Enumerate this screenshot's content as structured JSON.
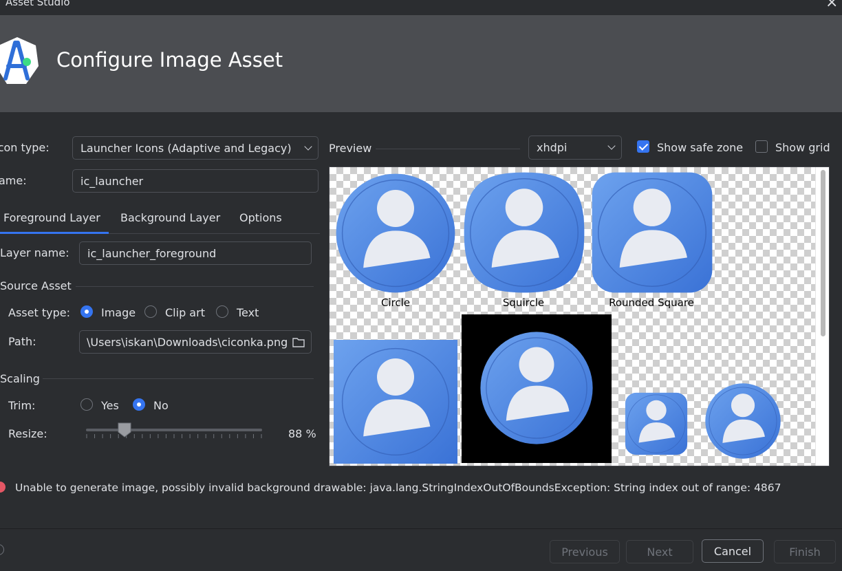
{
  "window": {
    "title": "Asset Studio"
  },
  "header": {
    "title": "Configure Image Asset"
  },
  "form": {
    "icon_type_label": "Icon type:",
    "icon_type_value": "Launcher Icons (Adaptive and Legacy)",
    "name_label": "Name:",
    "name_value": "ic_launcher"
  },
  "tabs": [
    {
      "label": "Foreground Layer",
      "selected": true
    },
    {
      "label": "Background Layer",
      "selected": false
    },
    {
      "label": "Options",
      "selected": false
    }
  ],
  "layer": {
    "layer_name_label": "Layer name:",
    "layer_name_value": "ic_launcher_foreground",
    "source_asset_title": "Source Asset",
    "asset_type_label": "Asset type:",
    "asset_types": [
      "Image",
      "Clip art",
      "Text"
    ],
    "asset_type_selected": "Image",
    "path_label": "Path:",
    "path_value": "\\Users\\iskan\\Downloads\\ciconka.png",
    "scaling_title": "Scaling",
    "trim_label": "Trim:",
    "trim_options": [
      "Yes",
      "No"
    ],
    "trim_selected": "No",
    "resize_label": "Resize:",
    "resize_value_text": "88 %",
    "resize_fraction": 0.22
  },
  "preview": {
    "label": "Preview",
    "density_value": "xhdpi",
    "show_safe_zone_label": "Show safe zone",
    "show_safe_zone_checked": true,
    "show_grid_label": "Show grid",
    "show_grid_checked": false,
    "captions": [
      "Circle",
      "Squircle",
      "Rounded Square"
    ]
  },
  "error": {
    "message": "Unable to generate image, possibly invalid background drawable: java.lang.StringIndexOutOfBoundsException: String index out of range: 4867",
    "color": "#e55765"
  },
  "footer": {
    "previous_label": "Previous",
    "next_label": "Next",
    "cancel_label": "Cancel",
    "finish_label": "Finish"
  },
  "colors": {
    "accent": "#3574f0",
    "banner": "#4b4d51",
    "background": "#2b2d30",
    "icon_blue": "#4a87e0"
  }
}
